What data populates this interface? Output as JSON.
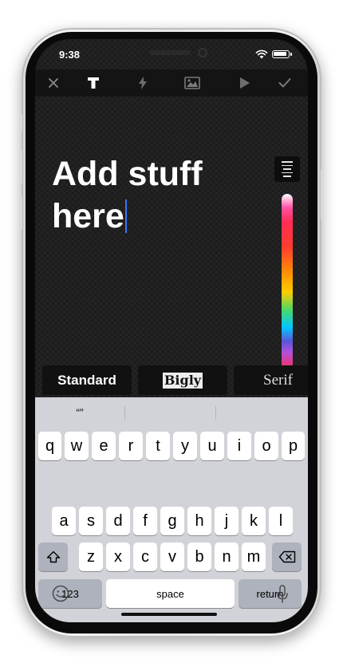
{
  "status_bar": {
    "time": "9:38"
  },
  "toolbar": {
    "tools": [
      {
        "name": "close-icon",
        "glyph": "✕"
      },
      {
        "name": "text-tool-icon",
        "glyph": "T"
      },
      {
        "name": "effects-icon",
        "glyph": "⚡"
      },
      {
        "name": "image-icon",
        "glyph": ""
      },
      {
        "name": "play-icon",
        "glyph": "▶"
      },
      {
        "name": "checkmark-icon",
        "glyph": "✓"
      }
    ]
  },
  "editor": {
    "line1": "Add stuff",
    "line2": "here"
  },
  "fonts": {
    "standard": "Standard",
    "bigly": "Bigly",
    "serif": "Serif"
  },
  "keyboard": {
    "suggestions": [
      "“”",
      "",
      ""
    ],
    "row1": [
      "q",
      "w",
      "e",
      "r",
      "t",
      "y",
      "u",
      "i",
      "o",
      "p"
    ],
    "row2": [
      "a",
      "s",
      "d",
      "f",
      "g",
      "h",
      "j",
      "k",
      "l"
    ],
    "row3": [
      "z",
      "x",
      "c",
      "v",
      "b",
      "n",
      "m"
    ],
    "numbers_label": "123",
    "space_label": "space",
    "return_label": "return"
  }
}
